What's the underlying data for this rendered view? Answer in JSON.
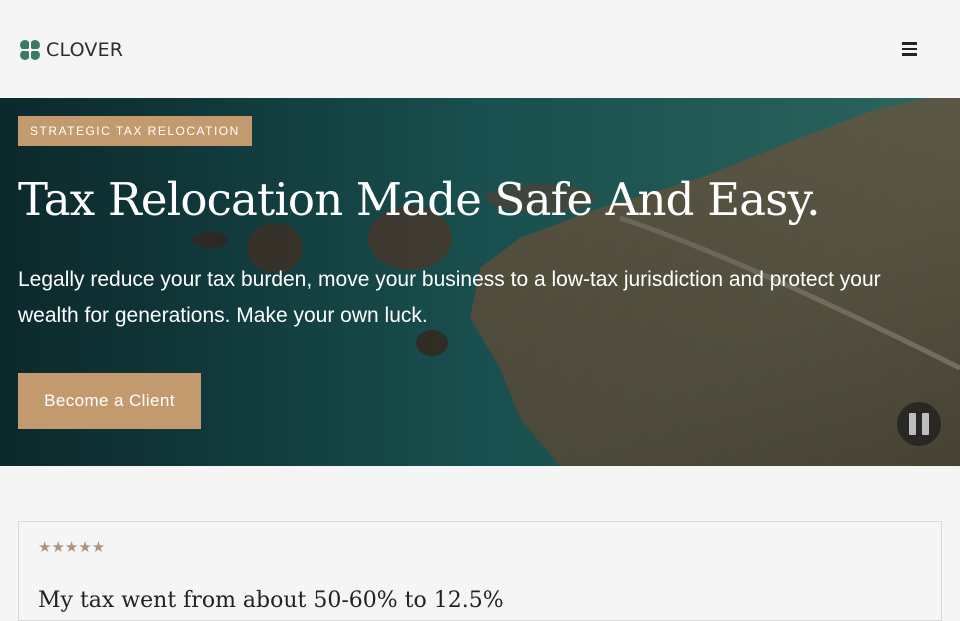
{
  "header": {
    "logo_text": "CLOVER",
    "menu_icon": "hamburger-menu-icon"
  },
  "hero": {
    "eyebrow": "STRATEGIC TAX RELOCATION",
    "title": "Tax Relocation Made Safe And Easy.",
    "subtitle": "Legally reduce your tax burden, move your business to a low-tax jurisdiction and protect your wealth for generations. Make your own luck.",
    "cta_label": "Become a Client",
    "pause_icon": "pause-icon"
  },
  "review": {
    "stars": "★★★★★",
    "rating": 5,
    "text": "My tax went from about 50-60% to 12.5%"
  },
  "colors": {
    "accent": "#c29a6e",
    "logo_green": "#3d7a62",
    "star": "#b0917a",
    "background": "#f5f5f5"
  }
}
